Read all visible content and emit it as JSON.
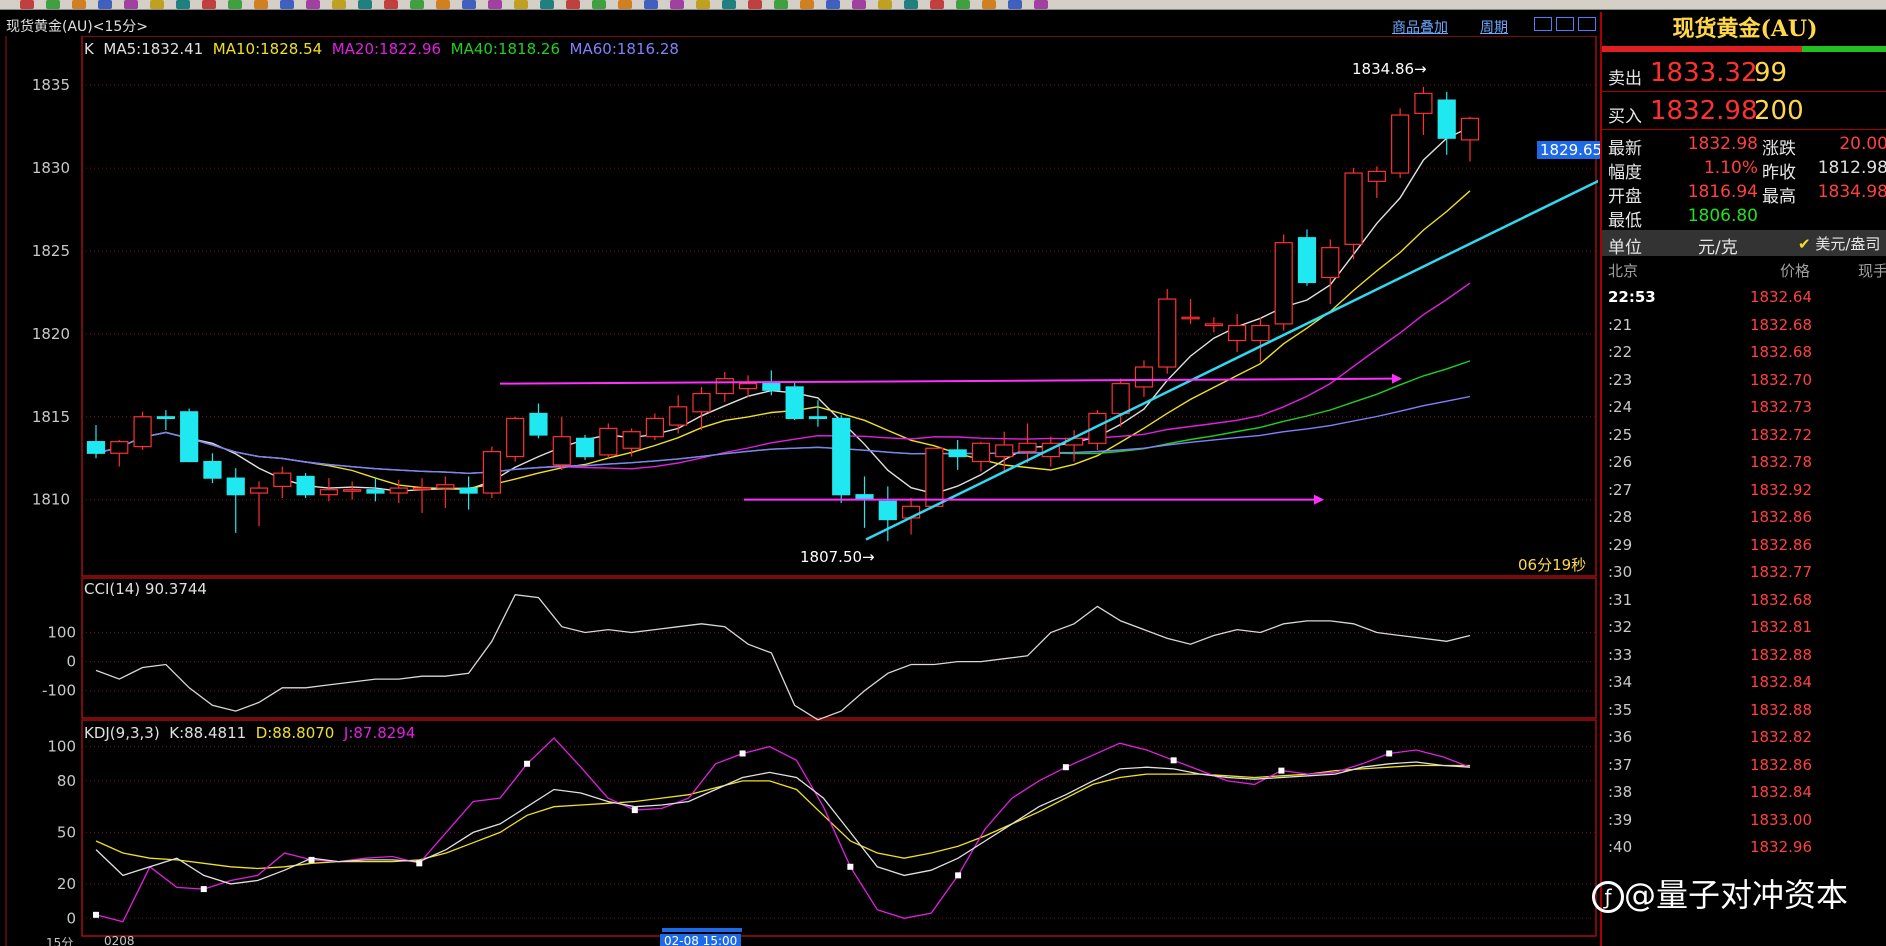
{
  "window": {
    "title": "现货黄金(AU)<15分>",
    "overlay_link": "商品叠加",
    "period_link": "周期"
  },
  "main_chart": {
    "label": "K",
    "ma": [
      {
        "name": "MA5",
        "text": "MA5:1832.41",
        "color": "#e0e0e0"
      },
      {
        "name": "MA10",
        "text": "MA10:1828.54",
        "color": "#f0e020"
      },
      {
        "name": "MA20",
        "text": "MA20:1822.96",
        "color": "#e020e0"
      },
      {
        "name": "MA40",
        "text": "MA40:1818.26",
        "color": "#20d020"
      },
      {
        "name": "MA60",
        "text": "MA60:1816.28",
        "color": "#8080ff"
      }
    ],
    "y_ticks": [
      "1835",
      "1830",
      "1825",
      "1820",
      "1815",
      "1810"
    ],
    "high_label": "1834.86",
    "low_label": "1807.50",
    "current_price_tag": "1829.65",
    "countdown": "06分19秒"
  },
  "cci": {
    "label": "CCI(14) 90.3744",
    "y_ticks": [
      "100",
      "0",
      "-100"
    ]
  },
  "kdj": {
    "label": "KDJ(9,3,3)",
    "k_text": "K:88.4811",
    "d_text": "D:88.8070",
    "j_text": "J:87.8294",
    "y_ticks": [
      "100",
      "80",
      "50",
      "20",
      "0"
    ]
  },
  "x_axis": {
    "left_label": "15分",
    "date_label": "0208",
    "crosshair_date": "02-08 15:00"
  },
  "quote_panel": {
    "title": "现货黄金(AU)",
    "sell_label": "卖出",
    "sell_price": "1833.32",
    "sell_qty": "99",
    "buy_label": "买入",
    "buy_price": "1832.98",
    "buy_qty": "200",
    "rows": [
      {
        "l1": "最新",
        "v1": "1832.98",
        "l2": "涨跌",
        "v2": "20.00"
      },
      {
        "l1": "幅度",
        "v1": "1.10%",
        "l2": "昨收",
        "v2": "1812.98"
      },
      {
        "l1": "开盘",
        "v1": "1816.94",
        "l2": "最高",
        "v2": "1834.98"
      },
      {
        "l1": "最低",
        "v1": "1806.80",
        "l2": "",
        "v2": ""
      }
    ],
    "unit_label": "单位",
    "unit_value": "元/克",
    "currency": "美元/盎司",
    "col_time": "北京",
    "col_price": "价格",
    "col_vol": "现手",
    "ticks": [
      {
        "t": "22:53",
        "p": "1832.64"
      },
      {
        "t": ":21",
        "p": "1832.68"
      },
      {
        "t": ":22",
        "p": "1832.68"
      },
      {
        "t": ":23",
        "p": "1832.70"
      },
      {
        "t": ":24",
        "p": "1832.73"
      },
      {
        "t": ":25",
        "p": "1832.72"
      },
      {
        "t": ":26",
        "p": "1832.78"
      },
      {
        "t": ":27",
        "p": "1832.92"
      },
      {
        "t": ":28",
        "p": "1832.86"
      },
      {
        "t": ":29",
        "p": "1832.86"
      },
      {
        "t": ":30",
        "p": "1832.77"
      },
      {
        "t": ":31",
        "p": "1832.68"
      },
      {
        "t": ":32",
        "p": "1832.81"
      },
      {
        "t": ":33",
        "p": "1832.88"
      },
      {
        "t": ":34",
        "p": "1832.84"
      },
      {
        "t": ":35",
        "p": "1832.88"
      },
      {
        "t": ":36",
        "p": "1832.82"
      },
      {
        "t": ":37",
        "p": "1832.86"
      },
      {
        "t": ":38",
        "p": "1832.84"
      },
      {
        "t": ":39",
        "p": "1833.00"
      },
      {
        "t": ":40",
        "p": "1832.96"
      }
    ]
  },
  "watermark": "@量子对冲资本",
  "chart_data": {
    "type": "candlestick",
    "ylim": [
      1806,
      1837
    ],
    "candles": [
      [
        1813.5,
        1814.5,
        1812.5,
        1812.8
      ],
      [
        1812.8,
        1813.6,
        1812.0,
        1813.5
      ],
      [
        1813.2,
        1815.3,
        1813.0,
        1815.0
      ],
      [
        1815.0,
        1815.4,
        1814.2,
        1814.9
      ],
      [
        1815.3,
        1815.5,
        1812.3,
        1812.3
      ],
      [
        1812.3,
        1812.8,
        1811.0,
        1811.3
      ],
      [
        1811.3,
        1811.9,
        1808.0,
        1810.3
      ],
      [
        1810.4,
        1811.1,
        1808.4,
        1810.7
      ],
      [
        1810.8,
        1812.0,
        1810.1,
        1811.6
      ],
      [
        1811.4,
        1811.6,
        1810.1,
        1810.3
      ],
      [
        1810.3,
        1811.3,
        1809.9,
        1810.6
      ],
      [
        1810.6,
        1811.1,
        1810.0,
        1810.6
      ],
      [
        1810.6,
        1811.3,
        1809.9,
        1810.4
      ],
      [
        1810.4,
        1811.2,
        1809.8,
        1810.7
      ],
      [
        1810.7,
        1811.3,
        1809.2,
        1810.7
      ],
      [
        1810.7,
        1811.4,
        1809.5,
        1810.9
      ],
      [
        1810.7,
        1811.4,
        1809.4,
        1810.4
      ],
      [
        1810.4,
        1813.2,
        1810.1,
        1812.9
      ],
      [
        1812.6,
        1815.0,
        1812.3,
        1814.9
      ],
      [
        1815.2,
        1815.8,
        1813.7,
        1813.9
      ],
      [
        1812.1,
        1815.0,
        1811.8,
        1813.8
      ],
      [
        1813.7,
        1813.9,
        1812.4,
        1812.6
      ],
      [
        1812.7,
        1814.6,
        1812.5,
        1814.3
      ],
      [
        1813.1,
        1814.3,
        1812.6,
        1814.1
      ],
      [
        1813.8,
        1815.2,
        1813.6,
        1814.9
      ],
      [
        1814.5,
        1816.3,
        1814.0,
        1815.6
      ],
      [
        1815.3,
        1816.8,
        1814.2,
        1816.4
      ],
      [
        1816.4,
        1817.7,
        1815.9,
        1817.3
      ],
      [
        1816.7,
        1817.5,
        1816.2,
        1817.0
      ],
      [
        1817.0,
        1817.8,
        1816.3,
        1816.6
      ],
      [
        1816.8,
        1817.1,
        1814.8,
        1814.9
      ],
      [
        1815.0,
        1816.0,
        1814.4,
        1814.9
      ],
      [
        1814.9,
        1815.1,
        1809.8,
        1810.3
      ],
      [
        1810.3,
        1811.4,
        1808.3,
        1810.0
      ],
      [
        1809.9,
        1810.8,
        1807.5,
        1808.8
      ],
      [
        1808.9,
        1810.1,
        1807.9,
        1809.6
      ],
      [
        1809.6,
        1812.7,
        1809.6,
        1813.1
      ],
      [
        1813.0,
        1813.6,
        1811.8,
        1812.6
      ],
      [
        1812.3,
        1813.5,
        1811.7,
        1813.4
      ],
      [
        1812.6,
        1814.1,
        1811.7,
        1813.3
      ],
      [
        1812.9,
        1814.6,
        1812.2,
        1813.4
      ],
      [
        1812.6,
        1813.8,
        1812.0,
        1813.4
      ],
      [
        1813.3,
        1814.2,
        1812.3,
        1813.7
      ],
      [
        1813.4,
        1815.4,
        1813.0,
        1815.2
      ],
      [
        1815.2,
        1817.3,
        1814.4,
        1817.0
      ],
      [
        1816.8,
        1818.4,
        1816.2,
        1818.0
      ],
      [
        1818.0,
        1822.7,
        1817.6,
        1822.1
      ],
      [
        1821.0,
        1822.1,
        1820.6,
        1821.0
      ],
      [
        1820.5,
        1821.0,
        1820.1,
        1820.6
      ],
      [
        1819.6,
        1821.2,
        1818.9,
        1820.5
      ],
      [
        1819.6,
        1821.0,
        1818.3,
        1820.5
      ],
      [
        1820.6,
        1826.0,
        1820.2,
        1825.5
      ],
      [
        1825.8,
        1826.3,
        1822.9,
        1823.1
      ],
      [
        1823.4,
        1825.7,
        1821.8,
        1825.2
      ],
      [
        1825.4,
        1830.0,
        1824.5,
        1829.7
      ],
      [
        1829.2,
        1830.1,
        1828.2,
        1829.8
      ],
      [
        1829.7,
        1833.6,
        1829.4,
        1833.2
      ],
      [
        1833.3,
        1834.9,
        1832.0,
        1834.5
      ],
      [
        1834.1,
        1834.6,
        1830.8,
        1831.8
      ],
      [
        1831.7,
        1833.1,
        1830.4,
        1833.0
      ]
    ]
  }
}
